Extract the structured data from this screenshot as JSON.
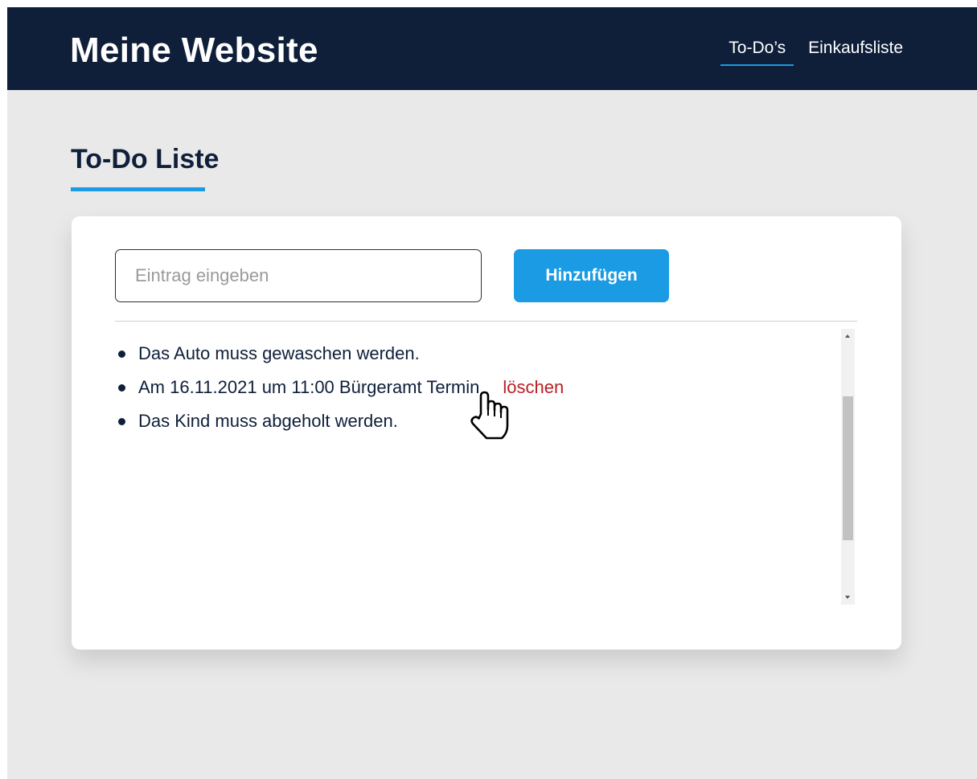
{
  "header": {
    "brand": "Meine Website",
    "nav": [
      {
        "label": "To-Do’s",
        "active": true
      },
      {
        "label": "Einkaufsliste",
        "active": false
      }
    ]
  },
  "main": {
    "title": "To-Do Liste",
    "input": {
      "placeholder": "Eintrag eingeben",
      "value": ""
    },
    "add_button_label": "Hinzufügen",
    "todos": [
      {
        "text": "Das Auto muss gewaschen werden."
      },
      {
        "text": "Am 16.11.2021 um 11:00 Bürgeramt Termin",
        "delete_label": "löschen"
      },
      {
        "text": "Das Kind muss abgeholt werden."
      }
    ]
  },
  "colors": {
    "header_bg": "#0f1f3a",
    "accent": "#1a9be3",
    "page_bg": "#e9e9e9",
    "delete": "#b72025"
  },
  "icons": {
    "cursor": "hand-pointer-icon"
  }
}
